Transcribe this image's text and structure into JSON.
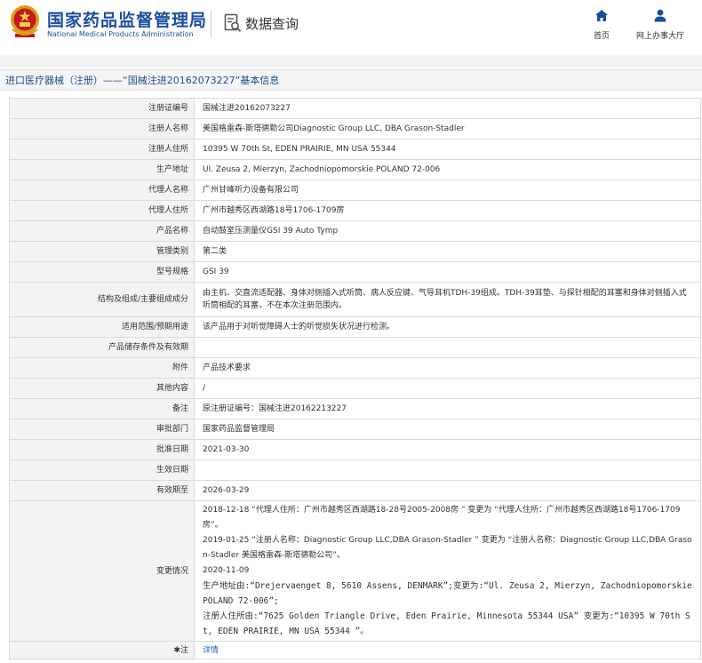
{
  "header": {
    "logo_cn": "国家药品监督管理局",
    "logo_en": "National Medical Products Administration",
    "query_title": "数据查询",
    "nav": [
      {
        "label": "首页",
        "icon": "home-icon"
      },
      {
        "label": "网上办事大厅",
        "icon": "user-icon"
      }
    ]
  },
  "breadcrumb": {
    "text": "进口医疗器械（注册）——“国械注进20162073227”基本信息"
  },
  "rows": [
    {
      "key": "注册证编号",
      "value": "国械注进20162073227"
    },
    {
      "key": "注册人名称",
      "value": "美国格雷森-斯塔德勒公司Diagnostic Group LLC, DBA Grason-Stadler"
    },
    {
      "key": "注册人住所",
      "value": "10395 W 70th St, EDEN PRAIRIE, MN USA 55344"
    },
    {
      "key": "生产地址",
      "value": "Ul. Zeusa 2, Mierzyn, Zachodniopomorskie POLAND 72-006"
    },
    {
      "key": "代理人名称",
      "value": "广州甘峰听力设备有限公司"
    },
    {
      "key": "代理人住所",
      "value": "广州市越秀区西湖路18号1706-1709房"
    },
    {
      "key": "产品名称",
      "value": "自动鼓室压测量仪GSI 39 Auto Tymp"
    },
    {
      "key": "管理类别",
      "value": "第二类"
    },
    {
      "key": "型号规格",
      "value": "GSI 39"
    },
    {
      "key": "结构及组成/主要组成成分",
      "value": "由主机、交直流适配器、身体对侧插入式听筒、病人反应键、气导耳机TDH-39组成。TDH-39耳垫、与探针相配的耳塞和身体对侧插入式听筒相配的耳塞，不在本次注册范围内。"
    },
    {
      "key": "适用范围/预期用途",
      "value": "该产品用于对听觉障碍人士的听觉损失状况进行检测。"
    },
    {
      "key": "产品储存条件及有效期",
      "value": ""
    },
    {
      "key": "附件",
      "value": "产品技术要求"
    },
    {
      "key": "其他内容",
      "value": "/"
    },
    {
      "key": "备注",
      "value": "原注册证编号：国械注进20162213227"
    },
    {
      "key": "审批部门",
      "value": "国家药品监督管理局"
    },
    {
      "key": "批准日期",
      "value": "2021-03-30"
    },
    {
      "key": "生效日期",
      "value": ""
    },
    {
      "key": "有效期至",
      "value": "2026-03-29"
    }
  ],
  "change": {
    "key": "变更情况",
    "lines": [
      "2018-12-18 “代理人住所：广州市越秀区西湖路18-28号2005-2008房 ” 变更为 “代理人住所：广州市越秀区西湖路18号1706-1709房”。",
      "2019-01-25 “注册人名称：Diagnostic Group LLC,DBA Grason-Stadler ” 变更为 “注册人名称：Diagnostic Group LLC,DBA Grason-Stadler 美国格雷森-斯塔德勒公司”。",
      "2020-11-09"
    ],
    "mono_lines": [
      "生产地址由:“Drejervaenget 8, 5610 Assens, DENMARK”;变更为:“Ul. Zeusa 2, Mierzyn, Zachodniopomorskie POLAND 72-006”;",
      "注册人住所由:“7625 Golden Triangle Drive, Eden Prairie, Minnesota 55344 USA” 变更为:“10395 W 70th St, EDEN PRAIRIE, MN USA 55344 ”。"
    ]
  },
  "note": {
    "key": "注",
    "link": "详情"
  }
}
